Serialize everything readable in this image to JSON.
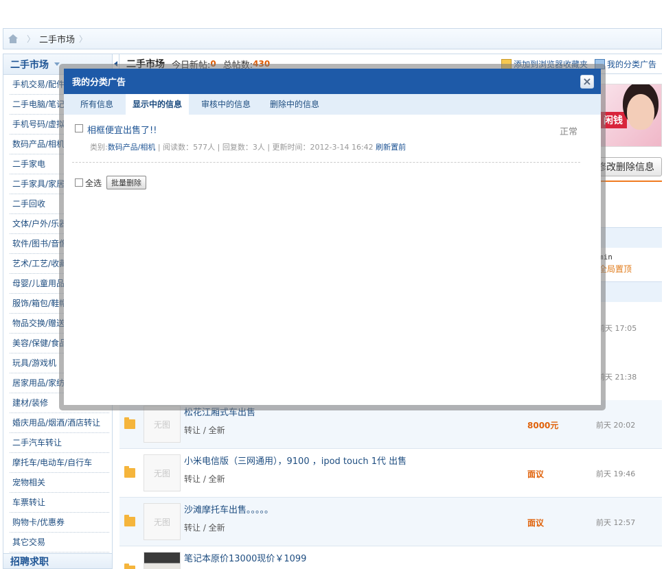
{
  "breadcrumb": {
    "sep": "〉",
    "current": "二手市场"
  },
  "sidebar": {
    "title": "二手市场",
    "items": [
      "手机交易/配件",
      "二手电脑/笔记",
      "手机号码/虚拟",
      "数码产品/相机",
      "二手家电",
      "二手家具/家居",
      "二手回收",
      "文体/户外/乐器",
      "软件/图书/音像",
      "艺术/工艺/收藏",
      "母婴/儿童用品",
      "服饰/箱包/鞋帽",
      "物品交换/赠送",
      "美容/保健/食品",
      "玩具/游戏机",
      "居家用品/家纺",
      "建材/装修",
      "婚庆用品/烟酒/酒店转让",
      "二手汽车转让",
      "摩托车/电动车/自行车",
      "宠物相关",
      "车票转让",
      "购物卡/优惠券",
      "其它交易"
    ],
    "footer": "招聘求职"
  },
  "topbar": {
    "market": "二手市场",
    "today_label": "今日新帖:",
    "today_count": "0",
    "total_label": "总帖数:",
    "total_count": "430",
    "bookmark": "添加到浏览器收藏夹",
    "my_ads": "我的分类广告"
  },
  "right": {
    "promo_tag": "闲钱",
    "modify_btn": "修改删除信息",
    "admin_name": "min",
    "admin_top": "全局置顶",
    "ghost_times": [
      "前天 17:05",
      "前天 21:38"
    ]
  },
  "listings": [
    {
      "title": "松花江厢式车出售",
      "meta": "转让 / 全新",
      "price": "8000元",
      "time": "前天 20:02",
      "thumb": "无图"
    },
    {
      "title": "小米电信版（三网通用），9100 ，ipod touch 1代 出售",
      "meta": "转让 / 全新",
      "price": "面议",
      "time": "前天 19:46",
      "thumb": "无图"
    },
    {
      "title": "沙滩摩托车出售。。。。。",
      "meta": "转让 / 全新",
      "price": "面议",
      "time": "前天 12:57",
      "thumb": "无图"
    },
    {
      "title": "笔记本原价13000现价￥1099",
      "meta": "",
      "price": "",
      "time": "",
      "thumb": ""
    }
  ],
  "modal": {
    "title": "我的分类广告",
    "close": "×",
    "tabs": [
      "所有信息",
      "显示中的信息",
      "审核中的信息",
      "删除中的信息"
    ],
    "active_tab": 1,
    "item": {
      "title": "相框便宜出售了!!",
      "status": "正常",
      "category_label": "类别:",
      "category": "数码产品/相机",
      "reads": "阅读数：577人",
      "replies": "回复数：3人",
      "updated": "更新时间：2012-3-14 16:42",
      "refresh": "刷新置前"
    },
    "select_all": "全选",
    "bulk_delete": "批量删除"
  }
}
